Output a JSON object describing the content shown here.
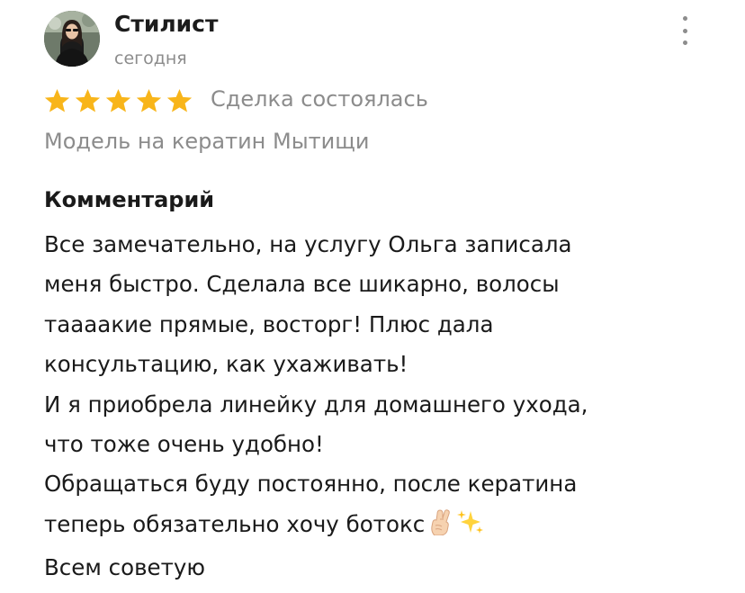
{
  "review": {
    "author": {
      "name": "Стилист",
      "date": "сегодня",
      "avatar": "avatar-photo"
    },
    "rating": {
      "value": 5,
      "max": 5,
      "star_color": "#f8b51a",
      "icon": "star-icon"
    },
    "deal_status": "Сделка состоялась",
    "listing_title": "Модель на кератин Мытищи",
    "comment": {
      "heading": "Комментарий",
      "lines": [
        "Все замечательно, на услугу Ольга записала",
        "меня быстро. Сделала все шикарно, волосы",
        "таааакие прямые, восторг! Плюс дала",
        "консультацию, как ухаживать!",
        "И я приобрела линейку для домашнего ухода,",
        "что тоже очень удобно!",
        "Обращаться буду постоянно, после кератина",
        "теперь обязательно хочу ботокс",
        "Всем советую"
      ],
      "emojis": [
        "crossed-fingers-icon",
        "sparkles-icon"
      ]
    },
    "menu_icon": "more-vertical-icon"
  }
}
